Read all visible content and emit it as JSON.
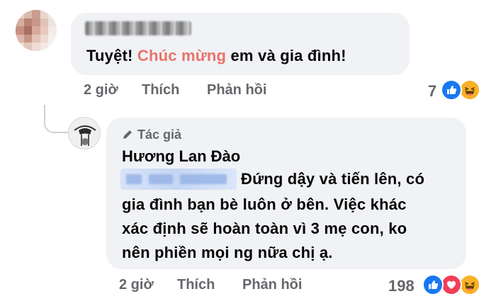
{
  "comment1": {
    "text_start": "Tuyệt! ",
    "text_accent": "Chúc mừng",
    "text_end": " em và gia đình!",
    "time": "2 giờ",
    "like_label": "Thích",
    "reply_label": "Phản hồi",
    "reaction_count": "7",
    "reactions": [
      "like-icon",
      "haha-icon"
    ],
    "accent_color": "#e9726b"
  },
  "comment2": {
    "author_badge": "Tác giả",
    "author_name": "Hương Lan Đào",
    "lines": [
      "Đứng dậy và tiến lên, có",
      "gia đình bạn bè luôn ở bên. Việc khác",
      "xác định sẽ hoàn toàn vì 3 mẹ con, ko",
      "nên phiền mọi ng nữa chị ạ."
    ],
    "time": "2 giờ",
    "like_label": "Thích",
    "reply_label": "Phản hồi",
    "reaction_count": "198",
    "reactions": [
      "like-icon",
      "love-icon",
      "haha-icon"
    ]
  },
  "colors": {
    "bubble": "#f0f2f5",
    "meta_text": "#65676b",
    "like": "#1877f2",
    "love": "#f33e58",
    "haha": "#f7b125"
  }
}
